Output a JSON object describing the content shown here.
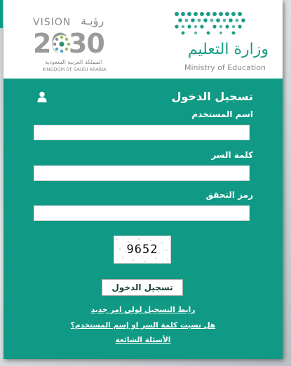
{
  "header": {
    "ministry_ar": "وزارة التعليم",
    "ministry_en": "Ministry of Education",
    "vision_word": "VISION",
    "vision_ar": "رؤيـة",
    "vision_year": "2030",
    "vision_country_ar": "المملكة العربية السعودية",
    "vision_country_en": "KINGDOM OF SAUDI ARABIA"
  },
  "login": {
    "title": "تسجيل الدخول",
    "username_label": "اسم المستخدم",
    "username_value": "",
    "password_label": "كلمة السر",
    "password_value": "",
    "captcha_label": "رمز التحقق",
    "captcha_value": "",
    "captcha_image_text": "9652",
    "submit_label": "تسجيل الدخول"
  },
  "links": {
    "guardian_register": "رابط التسجيل لولي امر جديد",
    "forgot": "هل نسيت كلمة السر او إسم المستخدم؟",
    "faq": "الأسئلة الشائعة"
  },
  "colors": {
    "panel": "#109a85",
    "accent": "#1a9c86"
  },
  "icons": {
    "user": "user-icon",
    "ministry_logo": "ministry-logo-icon",
    "vision_logo": "vision-2030-logo-icon"
  }
}
